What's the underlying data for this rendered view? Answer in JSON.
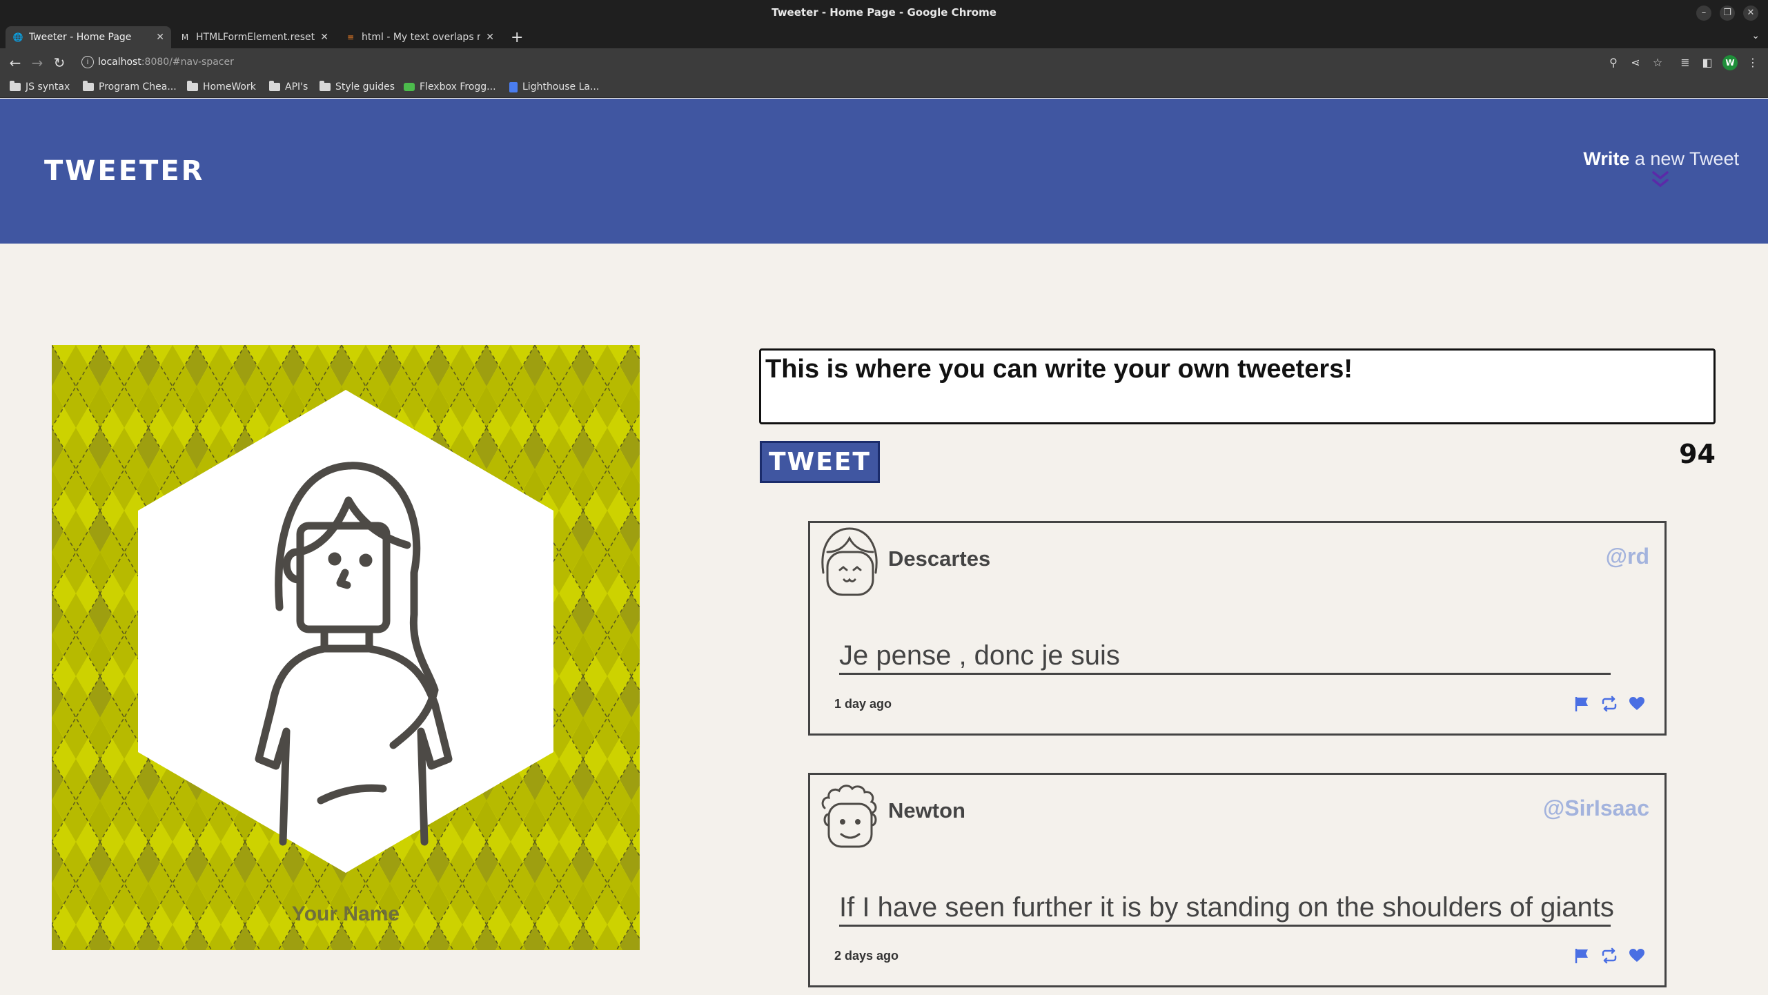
{
  "window": {
    "title": "Tweeter - Home Page - Google Chrome"
  },
  "tabs": [
    {
      "label": "Tweeter - Home Page",
      "icon": "globe-icon",
      "active": true
    },
    {
      "label": "HTMLFormElement.reset",
      "icon": "mdn-icon",
      "active": false
    },
    {
      "label": "html - My text overlaps m",
      "icon": "stackoverflow-icon",
      "active": false
    }
  ],
  "toolbar": {
    "url_host": "localhost",
    "url_rest": ":8080/#nav-spacer",
    "profile_initial": "W"
  },
  "bookmarks": [
    {
      "label": "JS syntax",
      "icon": "folder-icon"
    },
    {
      "label": "Program Chea...",
      "icon": "folder-icon"
    },
    {
      "label": "HomeWork",
      "icon": "folder-icon"
    },
    {
      "label": "API's",
      "icon": "folder-icon"
    },
    {
      "label": "Style guides",
      "icon": "folder-icon"
    },
    {
      "label": "Flexbox Frogg...",
      "icon": "frog-icon"
    },
    {
      "label": "Lighthouse La...",
      "icon": "document-icon"
    }
  ],
  "nav": {
    "brand": "TWEETER",
    "compose_bold": "Write",
    "compose_rest": " a new Tweet",
    "colors": {
      "nav_bg": "#4056a1",
      "page_bg": "#f4f1ec",
      "handle": "#a3b3dd",
      "accent": "#4a6fe3"
    }
  },
  "profile": {
    "name": "Your Name"
  },
  "new_tweet": {
    "text": "This is where you can write your own tweeters!",
    "button_label": "TWEET",
    "counter": "94"
  },
  "tweets": [
    {
      "name": "Descartes",
      "handle": "@rd",
      "content": "Je pense , donc je suis",
      "time": "1 day ago",
      "avatar": "girl-avatar-icon"
    },
    {
      "name": "Newton",
      "handle": "@SirIsaac",
      "content": "If I have seen further it is by standing on the shoulders of giants",
      "time": "2 days ago",
      "avatar": "curly-hair-avatar-icon"
    }
  ]
}
